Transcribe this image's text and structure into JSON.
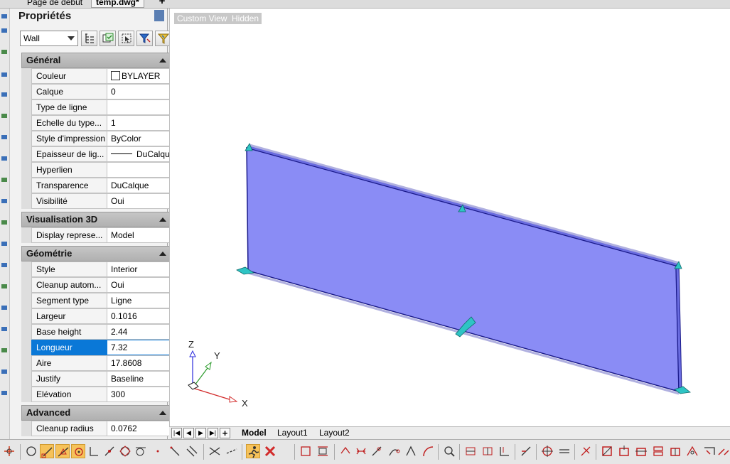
{
  "doc_tabs": [
    {
      "label": "Page de début",
      "active": false
    },
    {
      "label": "temp.dwg*",
      "active": true
    }
  ],
  "add_tab_label": "+",
  "properties": {
    "title": "Propriétés",
    "selector_value": "Wall",
    "sections": {
      "general": {
        "title": "Général",
        "rows": [
          {
            "key": "Couleur",
            "value": "BYLAYER"
          },
          {
            "key": "Calque",
            "value": "0"
          },
          {
            "key": "Type de ligne",
            "value": ""
          },
          {
            "key": "Echelle du type...",
            "value": "1"
          },
          {
            "key": "Style d'impression",
            "value": "ByColor"
          },
          {
            "key": "Epaisseur de lig...",
            "value": "DuCalque"
          },
          {
            "key": "Hyperlien",
            "value": ""
          },
          {
            "key": "Transparence",
            "value": "DuCalque"
          },
          {
            "key": "Visibilité",
            "value": "Oui"
          }
        ]
      },
      "vis3d": {
        "title": "Visualisation 3D",
        "rows": [
          {
            "key": "Display represe...",
            "value": "Model"
          }
        ]
      },
      "geometry": {
        "title": "Géométrie",
        "rows": [
          {
            "key": "Style",
            "value": "Interior"
          },
          {
            "key": "Cleanup autom...",
            "value": "Oui"
          },
          {
            "key": "Segment type",
            "value": "Ligne"
          },
          {
            "key": "Largeur",
            "value": "0.1016"
          },
          {
            "key": "Base height",
            "value": "2.44"
          },
          {
            "key": "Longueur",
            "value": "7.32"
          },
          {
            "key": "Aire",
            "value": "17.8608"
          },
          {
            "key": "Justify",
            "value": "Baseline"
          },
          {
            "key": "Elévation",
            "value": "300"
          }
        ]
      },
      "advanced": {
        "title": "Advanced",
        "rows": [
          {
            "key": "Cleanup radius",
            "value": "0.0762"
          }
        ]
      }
    },
    "selected_row": "Longueur"
  },
  "viewport": {
    "view_label": "Custom View",
    "style_label": "Hidden",
    "axis_x": "X",
    "axis_y": "Y",
    "axis_z": "Z",
    "wall_fill_color": "#8a8cf5",
    "grip_color": "#2ec4c4"
  },
  "layout_tabs": [
    {
      "label": "Model",
      "active": true
    },
    {
      "label": "Layout1",
      "active": false
    },
    {
      "label": "Layout2",
      "active": false
    }
  ],
  "layout_add_label": "+",
  "colors": {
    "selection": "#0a78d7",
    "snap_on": "#f6c25a"
  }
}
